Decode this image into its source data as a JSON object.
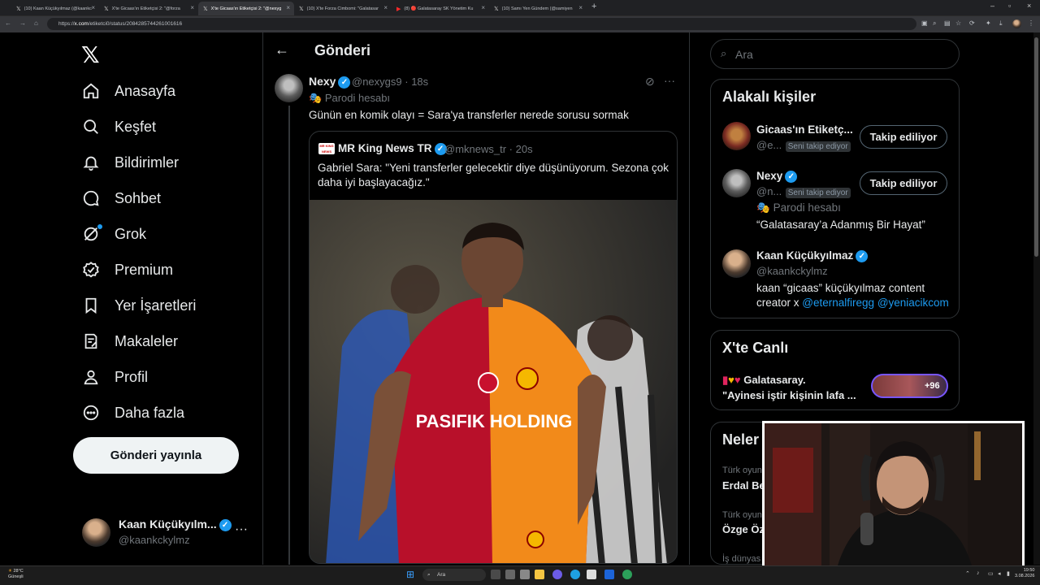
{
  "browser": {
    "tabs": [
      {
        "label": "(10) Kaan Küçükyılmaz (@kaankc",
        "icon": "x-logo-icon"
      },
      {
        "label": "X'te Gicaas'ın Etiketçisi 2: \"@forza",
        "icon": "x-logo-icon"
      },
      {
        "label": "X'te Gicaas'ın Etiketçisi 2: \"@nexyg",
        "icon": "x-logo-icon",
        "active": true
      },
      {
        "label": "(10) X'te Forza Cimbomi: \"Galatasar",
        "icon": "x-logo-icon"
      },
      {
        "label": "(8) 🔴 Galatasaray SK Yönetim Ku",
        "icon": "youtube-icon"
      },
      {
        "label": "(10) Samı Yen Gündem (@samiyen",
        "icon": "x-logo-icon"
      }
    ],
    "url_prefix": "https://",
    "url_domain": "x.com",
    "url_path": "/etiketci0/status/2084285744261001616"
  },
  "sidebar": {
    "logo": "𝕏",
    "items": [
      {
        "label": "Anasayfa",
        "icon": "home-icon"
      },
      {
        "label": "Keşfet",
        "icon": "search-icon"
      },
      {
        "label": "Bildirimler",
        "icon": "bell-icon"
      },
      {
        "label": "Sohbet",
        "icon": "chat-icon"
      },
      {
        "label": "Grok",
        "icon": "grok-icon"
      },
      {
        "label": "Premium",
        "icon": "premium-icon"
      },
      {
        "label": "Yer İşaretleri",
        "icon": "bookmark-icon"
      },
      {
        "label": "Makaleler",
        "icon": "articles-icon"
      },
      {
        "label": "Profil",
        "icon": "profile-icon"
      },
      {
        "label": "Daha fazla",
        "icon": "more-circle-icon"
      }
    ],
    "post_button": "Gönderi yayınla",
    "account": {
      "name": "Kaan Küçükyılm...",
      "handle": "@kaankckylmz",
      "more": "···"
    }
  },
  "main": {
    "title": "Gönderi",
    "post": {
      "name": "Nexy",
      "handle": "@nexygs9",
      "time": "· 18s",
      "label": "Parodi hesabı",
      "text": "Günün en komik olayı = Sara'ya transferler nerede sorusu sormak"
    },
    "quote": {
      "logo": "MR KING NEWS",
      "name": "MR King News TR",
      "handle": "@mknews_tr",
      "time": "· 20s",
      "text": "Gabriel Sara: \"Yeni transferler gelecektir diye düşünüyorum. Sezona çok daha iyi başlayacağız.\"",
      "sponsor": "PASIFIK HOLDING"
    }
  },
  "right": {
    "search_placeholder": "Ara",
    "related_title": "Alakalı kişiler",
    "people": [
      {
        "name": "Gicaas'ın Etiketç...",
        "handle": "@e...",
        "chip": "Seni takip ediyor",
        "button": "Takip ediliyor"
      },
      {
        "name": "Nexy",
        "handle": "@n...",
        "chip": "Seni takip ediyor",
        "button": "Takip ediliyor",
        "label": "Parodi hesabı",
        "bio": "“Galatasaray’a Adanmış Bir Hayat”"
      },
      {
        "name": "Kaan Küçükyılmaz",
        "handle": "@kaankckylmz",
        "bio_prefix": "kaan “gicaas” küçükyılmaz content creator x ",
        "link1": "@eternalfiregg",
        "link2": "@yeniacikcom"
      }
    ],
    "live_title": "X'te Canlı",
    "live_line1": "Galatasaray.",
    "live_line2": "\"Ayinesi iştir kişinin lafa ...",
    "live_count": "+96",
    "news_title": "Neler",
    "news": [
      {
        "category": "Türk oyun",
        "title": "Erdal Be"
      },
      {
        "category": "Türk oyun",
        "title": "Özge Öz"
      },
      {
        "category": "İş dünyas",
        "title": ""
      }
    ]
  },
  "taskbar": {
    "temp": "28°C",
    "weather": "Güneşli",
    "search": "Ara",
    "time": "19:50",
    "date": "3.08.2026"
  }
}
